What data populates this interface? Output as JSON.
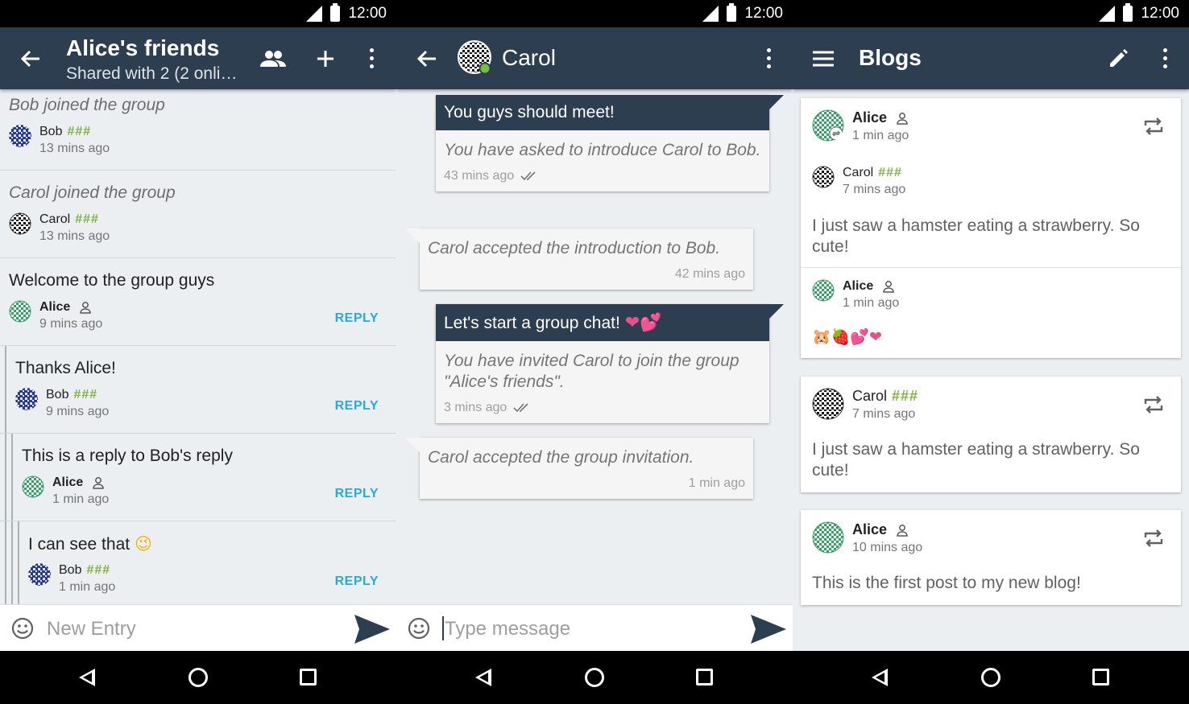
{
  "status": {
    "time": "12:00"
  },
  "colors": {
    "toolbar": "#2c3e50",
    "reply": "#29a9e1",
    "hash": "#7cb342",
    "bg": "#eceff1"
  },
  "forum": {
    "title": "Alice's friends",
    "subtitle": "Shared with 2 (2 onli…",
    "icons": {
      "back": "arrow-left-icon",
      "members": "people-icon",
      "add": "plus-icon",
      "menu": "more-vert-icon"
    },
    "posts": [
      {
        "text": "Bob joined the group",
        "author": "Bob",
        "badge": "###",
        "time": "13 mins ago",
        "italic": true
      },
      {
        "text": "Carol joined the group",
        "author": "Carol",
        "badge": "###",
        "time": "13 mins ago",
        "italic": true
      },
      {
        "text": "Welcome to the group guys",
        "author": "Alice",
        "time": "9 mins ago",
        "reply": "REPLY"
      },
      {
        "text": "Thanks Alice!",
        "author": "Bob",
        "badge": "###",
        "time": "9 mins ago",
        "reply": "REPLY"
      },
      {
        "text": "This is a reply to Bob's reply",
        "author": "Alice",
        "time": "1 min ago",
        "reply": "REPLY"
      },
      {
        "text": "I can see that",
        "emoji": "😉",
        "author": "Bob",
        "badge": "###",
        "time": "1 min ago",
        "reply": "REPLY"
      }
    ],
    "input_placeholder": "New Entry"
  },
  "chat": {
    "title": "Carol",
    "messages": [
      {
        "header": "You guys should meet!",
        "text": "You have asked to introduce Carol to Bob.",
        "time": "43 mins ago",
        "outgoing": true
      },
      {
        "text": "Carol accepted the introduction to Bob.",
        "time": "42 mins ago",
        "outgoing": false
      },
      {
        "header": "Let's start a group chat!",
        "hearts": "❤💕",
        "text": "You have invited Carol to join the group \"Alice's friends\".",
        "time": "3 mins ago",
        "outgoing": true
      },
      {
        "text": "Carol accepted the group invitation.",
        "time": "1 min ago",
        "outgoing": false
      }
    ],
    "input_placeholder": "Type message"
  },
  "blogs": {
    "title": "Blogs",
    "cards": [
      {
        "author": "Alice",
        "time": "1 min ago",
        "reblog": {
          "author": "Carol",
          "badge": "###",
          "time": "7 mins ago",
          "text": "I just saw a hamster eating a strawberry. So cute!"
        },
        "comment": {
          "author": "Alice",
          "time": "1 min ago",
          "text": "🐹🍓💕❤"
        }
      },
      {
        "author": "Carol",
        "badge": "###",
        "time": "7 mins ago",
        "text": "I just saw a hamster eating a strawberry. So cute!"
      },
      {
        "author": "Alice",
        "time": "10 mins ago",
        "text": "This is the first post to my new blog!"
      }
    ]
  }
}
